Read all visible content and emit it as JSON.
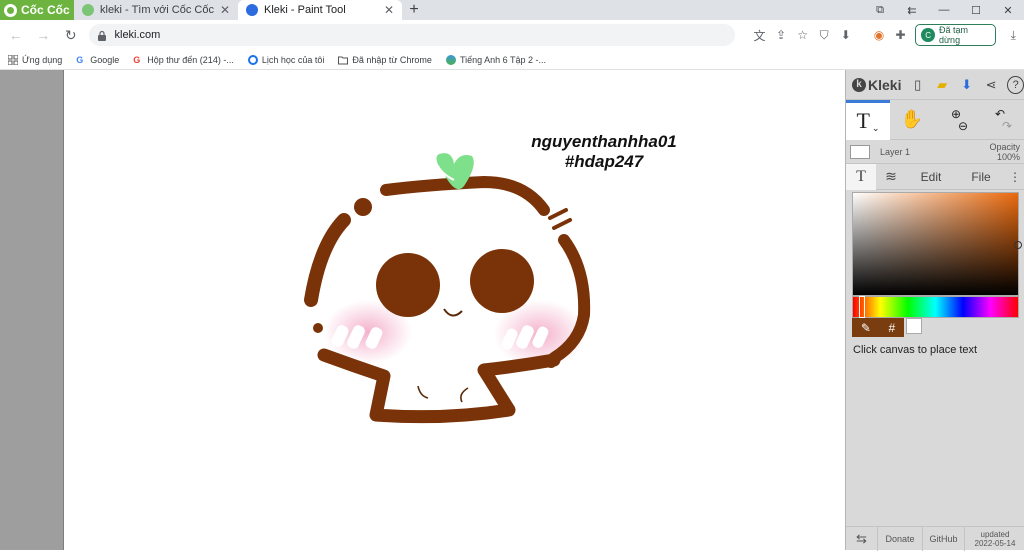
{
  "browser": {
    "brand": "Cốc Cốc",
    "tabs": [
      {
        "title": "kleki - Tìm với Cốc Cốc",
        "active": false
      },
      {
        "title": "Kleki - Paint Tool",
        "active": true
      }
    ],
    "url": "kleki.com",
    "profile_label": "Đã tạm dừng",
    "profile_initial": "C"
  },
  "bookmarks": [
    {
      "label": "Ứng dụng",
      "icon": "apps-grid-icon"
    },
    {
      "label": "Google",
      "icon": "google-icon"
    },
    {
      "label": "Hộp thư đến (214) -...",
      "icon": "gmail-icon"
    },
    {
      "label": "Lịch học của tôi",
      "icon": "web-icon"
    },
    {
      "label": "Đã nhập từ Chrome",
      "icon": "folder-icon"
    },
    {
      "label": "Tiếng Anh 6 Tập 2 -...",
      "icon": "globe-icon"
    }
  ],
  "canvas": {
    "caption_line1": "nguyenthanhha01",
    "caption_line2": "#hdap247"
  },
  "kleki": {
    "logo_text": "Kleki",
    "active_tool": "T",
    "layer_name": "Layer 1",
    "opacity_label": "Opacity",
    "opacity_value": "100%",
    "tabs": [
      "Edit",
      "File"
    ],
    "hex_symbol": "#",
    "hint": "Click canvas to place text",
    "bottom": {
      "donate": "Donate",
      "github": "GitHub",
      "updated_label": "updated",
      "updated_date": "2022-05-14"
    },
    "colors": {
      "primary": "#7a3d10",
      "secondary": "#ffffff",
      "picker_hue": "#ea6a0e"
    }
  }
}
